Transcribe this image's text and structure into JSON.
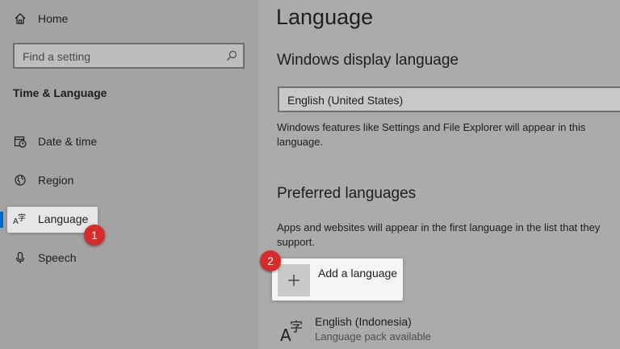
{
  "sidebar": {
    "home_label": "Home",
    "search_placeholder": "Find a setting",
    "section_title": "Time & Language",
    "items": [
      {
        "label": "Date & time",
        "icon": "calendar-clock-icon"
      },
      {
        "label": "Region",
        "icon": "globe-icon"
      },
      {
        "label": "Language",
        "icon": "language-icon",
        "active": true
      },
      {
        "label": "Speech",
        "icon": "microphone-icon"
      }
    ]
  },
  "main": {
    "page_title": "Language",
    "display_language": {
      "heading": "Windows display language",
      "selected": "English (United States)",
      "description_line1": "Windows features like Settings and File Explorer will appear in this",
      "description_line2": "language."
    },
    "preferred": {
      "heading": "Preferred languages",
      "description_line1": "Apps and websites will appear in the first language in the list that they",
      "description_line2": "support.",
      "add_label": "Add a language",
      "languages": [
        {
          "name": "English (Indonesia)",
          "status": "Language pack available"
        }
      ]
    }
  },
  "annotations": {
    "badge1": "1",
    "badge2": "2",
    "badge_color": "#d62b2b"
  },
  "colors": {
    "accent": "#0067c0"
  }
}
